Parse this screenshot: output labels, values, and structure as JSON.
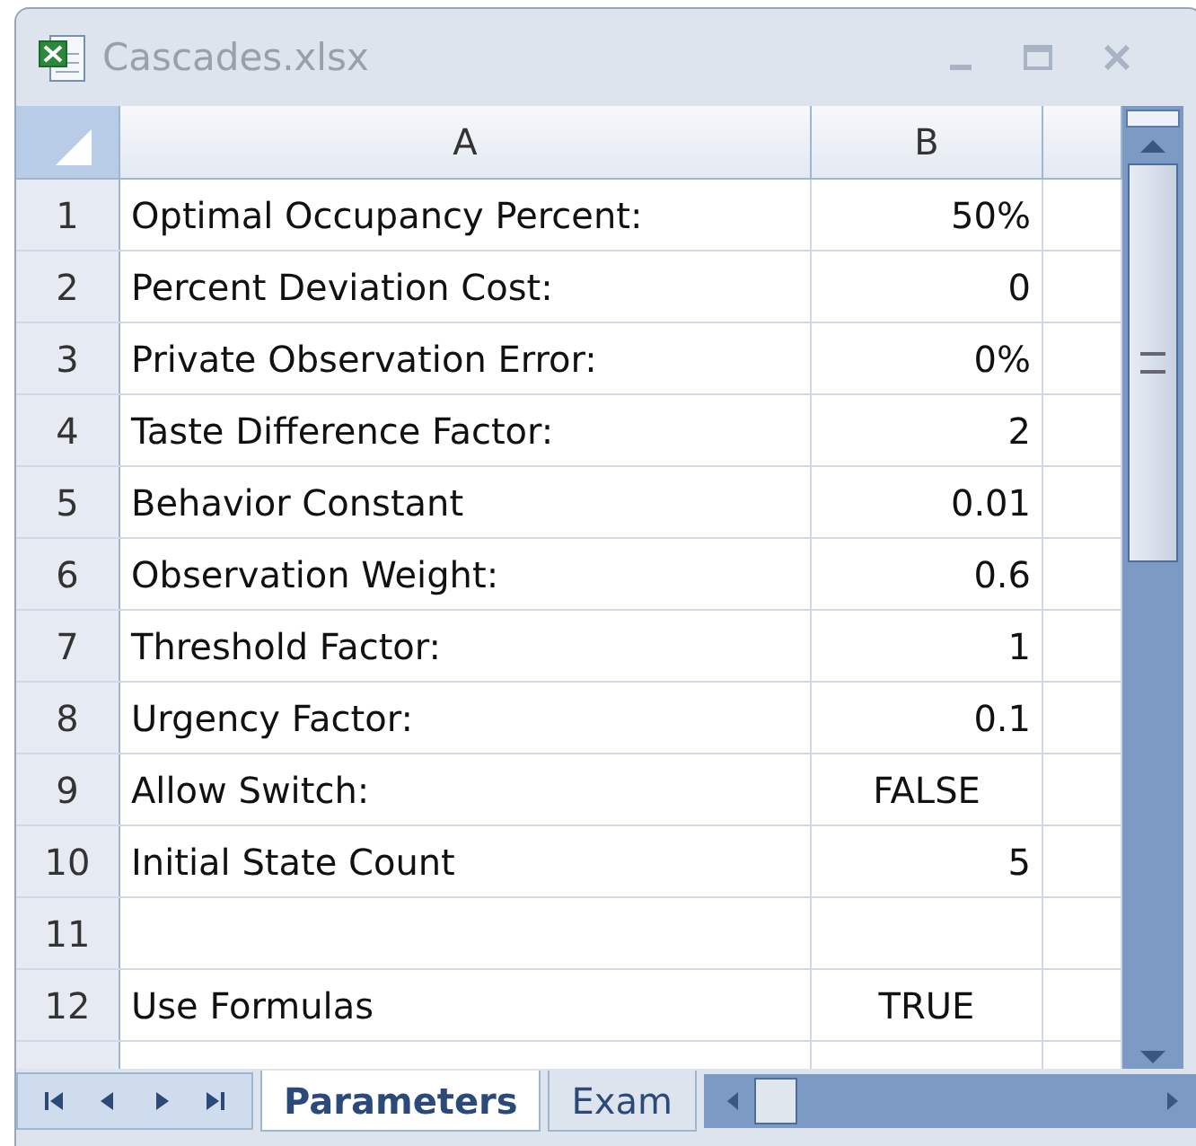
{
  "window": {
    "title": "Cascades.xlsx"
  },
  "columns": [
    {
      "label": "A"
    },
    {
      "label": "B"
    }
  ],
  "rows": [
    {
      "number": "1",
      "a": "Optimal Occupancy Percent:",
      "b": "50%",
      "kind": "number"
    },
    {
      "number": "2",
      "a": "Percent Deviation Cost:",
      "b": "0",
      "kind": "number"
    },
    {
      "number": "3",
      "a": "Private Observation Error:",
      "b": "0%",
      "kind": "number"
    },
    {
      "number": "4",
      "a": "Taste Difference Factor:",
      "b": "2",
      "kind": "number"
    },
    {
      "number": "5",
      "a": "Behavior Constant",
      "b": "0.01",
      "kind": "number"
    },
    {
      "number": "6",
      "a": "Observation Weight:",
      "b": "0.6",
      "kind": "number"
    },
    {
      "number": "7",
      "a": "Threshold Factor:",
      "b": "1",
      "kind": "number"
    },
    {
      "number": "8",
      "a": "Urgency Factor:",
      "b": "0.1",
      "kind": "number"
    },
    {
      "number": "9",
      "a": "Allow Switch:",
      "b": "FALSE",
      "kind": "boolean"
    },
    {
      "number": "10",
      "a": "Initial State Count",
      "b": "5",
      "kind": "number"
    },
    {
      "number": "11"
    },
    {
      "number": "12",
      "a": "Use Formulas",
      "b": "TRUE",
      "kind": "boolean"
    }
  ],
  "sheet_tabs": [
    {
      "label": "Parameters",
      "selected": true
    },
    {
      "label": "Exam",
      "selected": false
    }
  ]
}
